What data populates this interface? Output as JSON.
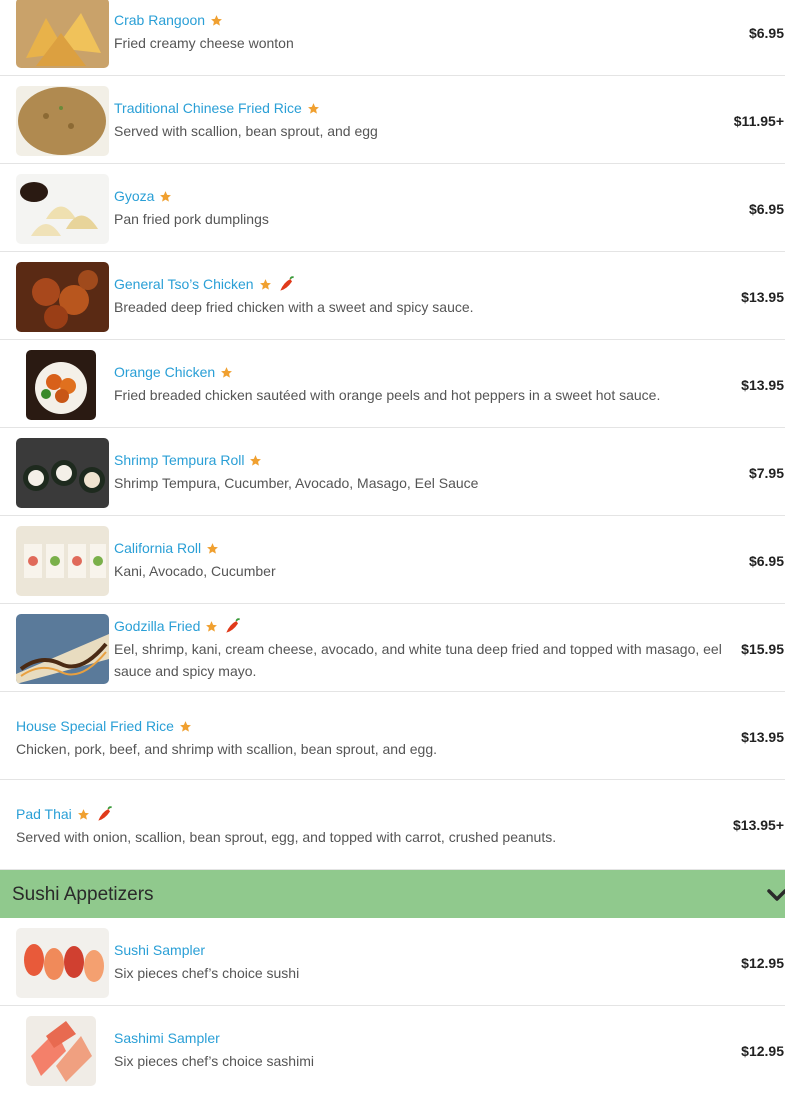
{
  "items_top": [
    {
      "name": "Crab Rangoon",
      "desc": "Fried creamy cheese wonton",
      "price": "$6.95",
      "spicy": false
    },
    {
      "name": "Traditional Chinese Fried Rice",
      "desc": "Served with scallion, bean sprout, and egg",
      "price": "$11.95+",
      "spicy": false
    },
    {
      "name": "Gyoza",
      "desc": "Pan fried pork dumplings",
      "price": "$6.95",
      "spicy": false
    },
    {
      "name": "General Tso’s Chicken",
      "desc": "Breaded deep fried chicken with a sweet and spicy sauce.",
      "price": "$13.95",
      "spicy": true
    },
    {
      "name": "Orange Chicken",
      "desc": "Fried breaded chicken sautéed with orange peels and hot peppers in a sweet hot sauce.",
      "price": "$13.95",
      "spicy": false
    },
    {
      "name": "Shrimp Tempura Roll",
      "desc": "Shrimp Tempura, Cucumber, Avocado, Masago, Eel Sauce",
      "price": "$7.95",
      "spicy": false
    },
    {
      "name": "California Roll",
      "desc": "Kani, Avocado, Cucumber",
      "price": "$6.95",
      "spicy": false
    },
    {
      "name": "Godzilla Fried",
      "desc": "Eel, shrimp, kani, cream cheese, avocado, and white tuna deep fried and topped with masago, eel sauce and spicy mayo.",
      "price": "$15.95",
      "spicy": true
    },
    {
      "name": "House Special Fried Rice",
      "desc": "Chicken, pork, beef, and shrimp with scallion, bean sprout, and egg.",
      "price": "$13.95",
      "spicy": false
    },
    {
      "name": "Pad Thai",
      "desc": "Served with onion, scallion, bean sprout, egg, and topped with carrot, crushed peanuts.",
      "price": "$13.95+",
      "spicy": true
    }
  ],
  "section": {
    "title": "Sushi Appetizers",
    "icon": "chevron-down-icon"
  },
  "items_sushi": [
    {
      "name": "Sushi Sampler",
      "desc": "Six pieces chef’s choice sushi",
      "price": "$12.95",
      "spicy": false
    },
    {
      "name": "Sashimi Sampler",
      "desc": "Six pieces chef’s choice sashimi",
      "price": "$12.95",
      "spicy": false
    }
  ],
  "icons": {
    "star": "star-icon",
    "pepper": "chili-pepper-icon"
  },
  "colors": {
    "link": "#2a9fd6",
    "star": "#f0a030",
    "section_bg": "#90c98d"
  }
}
